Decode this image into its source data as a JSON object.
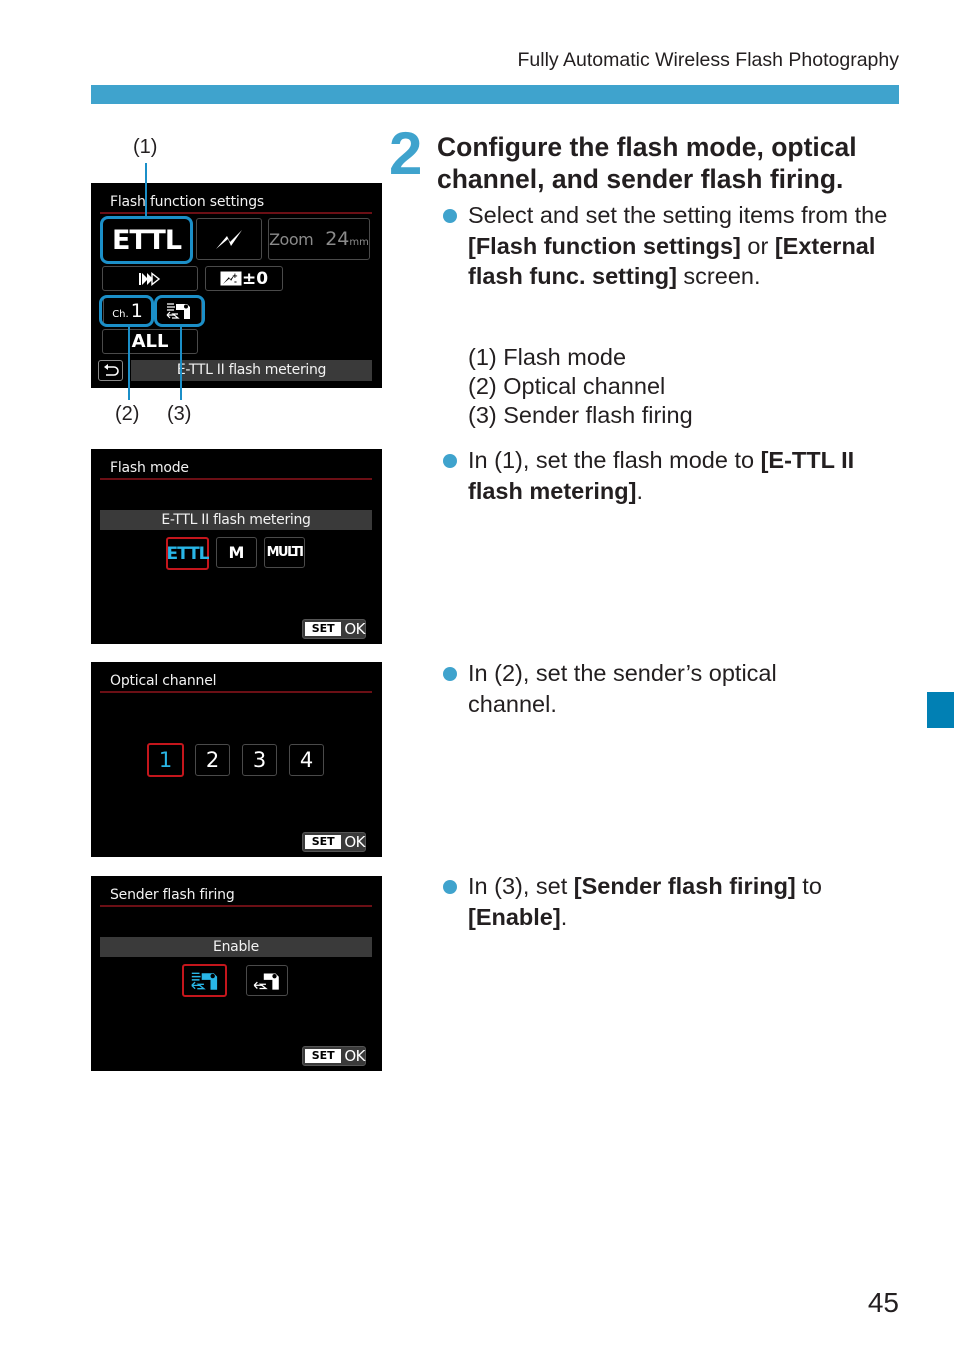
{
  "page": {
    "running_head": "Fully Automatic Wireless Flash Photography",
    "page_number": "45",
    "accent_color": "#3fa3cd",
    "side_tab_color": "#0180b4"
  },
  "figure1": {
    "callouts": [
      "(1)",
      "(2)",
      "(3)"
    ],
    "screen_title": "Flash function settings",
    "flash_mode": "ETTL",
    "zoom_label": "Zoom",
    "zoom_value": "24",
    "zoom_unit": "mm",
    "flash_exposure_comp": "±0",
    "channel_prefix": "Ch.",
    "channel_value": "1",
    "group": "ALL",
    "status_text": "E-TTL II flash metering",
    "highlight_color": "#1b8fc8"
  },
  "figure2": {
    "screen_title": "Flash mode",
    "selected_label": "E-TTL II flash metering",
    "options": [
      "ETTL",
      "M",
      "MULTI"
    ],
    "selected_index": 0,
    "set_label": "SET",
    "ok_label": "OK"
  },
  "figure3": {
    "screen_title": "Optical channel",
    "options": [
      "1",
      "2",
      "3",
      "4"
    ],
    "selected_index": 0,
    "set_label": "SET",
    "ok_label": "OK"
  },
  "figure4": {
    "screen_title": "Sender flash firing",
    "selected_label": "Enable",
    "options": [
      "sender-flash-enable-icon",
      "sender-flash-disable-icon"
    ],
    "selected_index": 0,
    "set_label": "SET",
    "ok_label": "OK"
  },
  "step": {
    "number": "2",
    "title": "Configure the flash mode, optical channel, and sender flash firing.",
    "bullet1": {
      "t1": "Select and set the setting items from the ",
      "b1": "[Flash function settings]",
      "t2": " or ",
      "b2": "[External flash func. setting]",
      "t3": " screen."
    },
    "legend": [
      "(1) Flash mode",
      "(2) Optical channel",
      "(3) Sender flash firing"
    ],
    "bullet2": {
      "t1": "In (1), set the flash mode to ",
      "b1": "[E-TTL II flash metering]",
      "t2": "."
    },
    "bullet3": {
      "t1": "In (2), set the sender’s optical channel."
    },
    "bullet4": {
      "t1": "In (3), set ",
      "b1": "[Sender flash firing]",
      "t2": " to ",
      "b2": "[Enable]",
      "t3": "."
    }
  }
}
